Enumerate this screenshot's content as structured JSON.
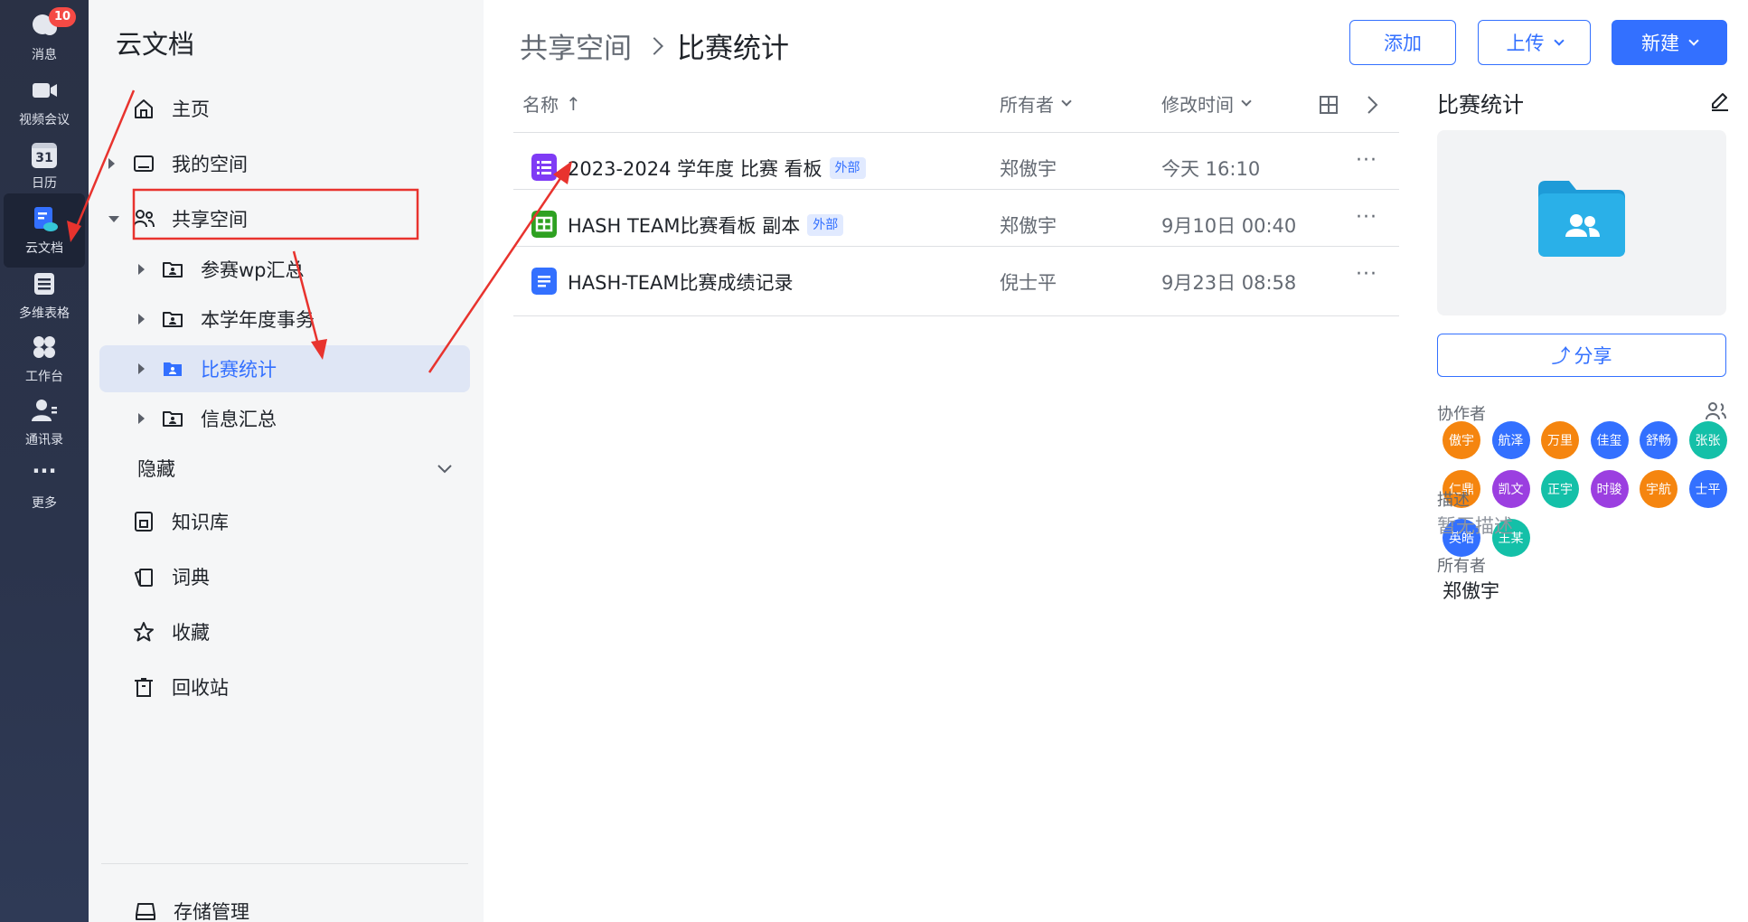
{
  "rail": {
    "items": [
      {
        "label": "消息",
        "icon": "message-icon",
        "badge": "10"
      },
      {
        "label": "视频会议",
        "icon": "video-icon"
      },
      {
        "label": "日历",
        "icon": "calendar-icon",
        "icon_text": "31"
      },
      {
        "label": "云文档",
        "icon": "cloud-doc-icon",
        "active": true
      },
      {
        "label": "多维表格",
        "icon": "base-table-icon"
      },
      {
        "label": "工作台",
        "icon": "workplace-icon"
      },
      {
        "label": "通讯录",
        "icon": "contacts-icon"
      },
      {
        "label": "更多",
        "icon": "more-icon",
        "icon_text": "···"
      }
    ]
  },
  "nav": {
    "title": "云文档",
    "home": "主页",
    "my_space": "我的空间",
    "shared_space": "共享空间",
    "shared_children": [
      "参赛wp汇总",
      "本学年度事务",
      "比赛统计",
      "信息汇总"
    ],
    "hidden": "隐藏",
    "knowledge_base": "知识库",
    "dictionary": "词典",
    "favorites": "收藏",
    "trash": "回收站",
    "storage": "存储管理"
  },
  "breadcrumb": {
    "parent": "共享空间",
    "current": "比赛统计"
  },
  "toolbar": {
    "add": "添加",
    "upload": "上传",
    "create": "新建"
  },
  "table": {
    "col_name": "名称",
    "col_name_sort": "↑",
    "col_owner": "所有者",
    "col_modified": "修改时间",
    "more": "···",
    "rows": [
      {
        "name": "2023-2024 学年度 比赛 看板",
        "tag": "外部",
        "owner": "郑傲宇",
        "modified": "今天 16:10",
        "type": "board",
        "color": "#7f3bf5"
      },
      {
        "name": "HASH TEAM比赛看板 副本",
        "tag": "外部",
        "owner": "郑傲宇",
        "modified": "9月10日 00:40",
        "type": "sheet",
        "color": "#2ea121"
      },
      {
        "name": "HASH-TEAM比赛成绩记录",
        "tag": "",
        "owner": "倪士平",
        "modified": "9月23日 08:58",
        "type": "doc",
        "color": "#3370ff"
      }
    ]
  },
  "detail": {
    "title": "比赛统计",
    "share": "分享",
    "collaborators_label": "协作者",
    "collaborators": [
      {
        "name": "傲宇",
        "color": "#f5850f"
      },
      {
        "name": "航泽",
        "color": "#3370ff"
      },
      {
        "name": "万里",
        "color": "#f5850f"
      },
      {
        "name": "佳玺",
        "color": "#3370ff"
      },
      {
        "name": "舒畅",
        "color": "#3370ff"
      },
      {
        "name": "张张",
        "color": "#14c0a8"
      },
      {
        "name": "仁鼎",
        "color": "#f5850f"
      },
      {
        "name": "凯文",
        "color": "#9b3fe0"
      },
      {
        "name": "正宇",
        "color": "#14c0a8"
      },
      {
        "name": "时骏",
        "color": "#9b3fe0"
      },
      {
        "name": "宇航",
        "color": "#f5850f"
      },
      {
        "name": "士平",
        "color": "#3370ff"
      },
      {
        "name": "英皓",
        "color": "#3370ff"
      },
      {
        "name": "王某",
        "color": "#14c0a8"
      }
    ],
    "description_label": "描述",
    "description": "暂无描述",
    "owner_label": "所有者",
    "owner": "郑傲宇"
  },
  "colors": {
    "accent": "#3370ff",
    "annotation": "#e8332e",
    "folder": "#2ab0e8"
  }
}
